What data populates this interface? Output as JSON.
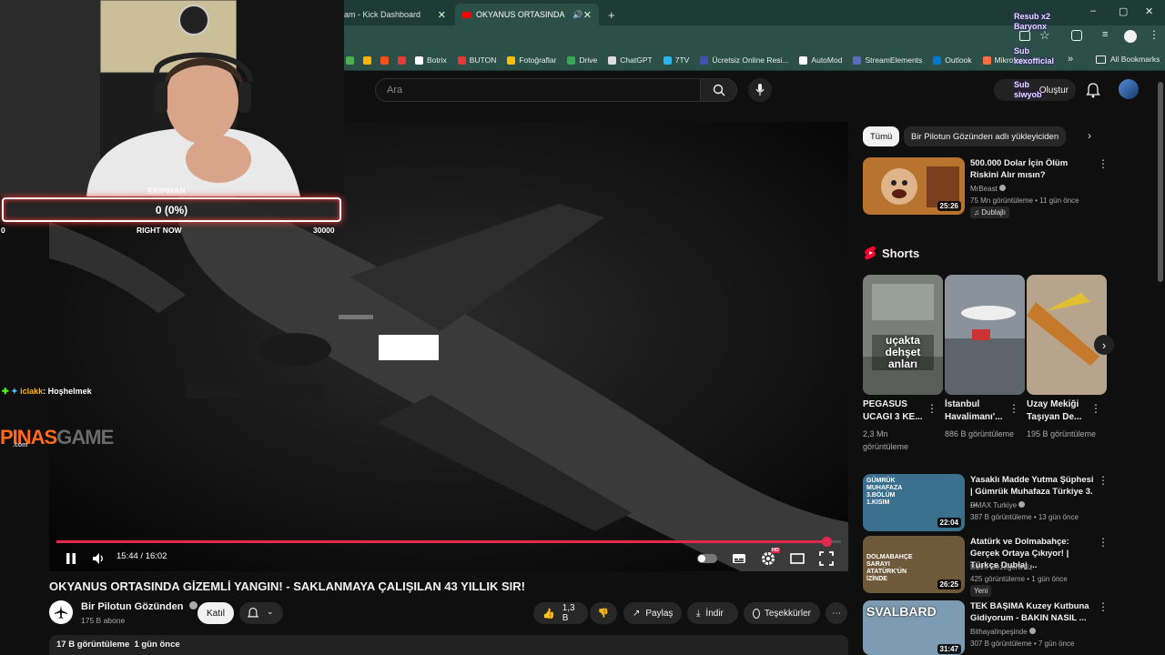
{
  "browser": {
    "tabs": [
      {
        "label": "am - Kick Dashboard",
        "active": false
      },
      {
        "label": "OKYANUS ORTASINDA GİZ",
        "active": true
      }
    ],
    "new_tab": "+",
    "window_controls": [
      "–",
      "▢",
      "✕"
    ],
    "bookmarks": [
      {
        "label": "",
        "color": "#4caf50"
      },
      {
        "label": "",
        "color": "#ffb300"
      },
      {
        "label": "",
        "color": "#f4511e"
      },
      {
        "label": "",
        "color": "#e53935"
      },
      {
        "label": "Botrix",
        "color": "#ffffff"
      },
      {
        "label": "BUTON",
        "color": "#e53935"
      },
      {
        "label": "Fotoğraflar",
        "color": "#fbbc04"
      },
      {
        "label": "Drive",
        "color": "#34a853"
      },
      {
        "label": "ChatGPT",
        "color": "#dddddd"
      },
      {
        "label": "7TV",
        "color": "#29b6f6"
      },
      {
        "label": "Ücretsiz Online Resi...",
        "color": "#3f51b5"
      },
      {
        "label": "AutoMod",
        "color": "#ffffff"
      },
      {
        "label": "StreamElements",
        "color": "#5c6bc0"
      },
      {
        "label": "Outlook",
        "color": "#0078d4"
      },
      {
        "label": "Mikrofon",
        "color": "#ff7043"
      }
    ],
    "bookmarks_more": "»",
    "all_bookmarks": "All Bookmarks"
  },
  "youtube": {
    "search_placeholder": "Ara",
    "create_label": "Oluştur",
    "video": {
      "title": "OKYANUS ORTASINDA GİZEMLİ YANGIN! - SAKLANMAYA ÇALIŞILAN 43 YILLIK SIR!",
      "timecode": "15:44 / 16:02",
      "progress": 0.981,
      "hd_badge": "HD"
    },
    "channel": {
      "name": "Bir Pilotun Gözünden",
      "subscribers": "175 B abone",
      "join_label": "Katıl"
    },
    "actions": {
      "likes": "1,3 B",
      "share": "Paylaş",
      "download": "İndir",
      "thanks": "Teşekkürler",
      "more": "⋯"
    },
    "description": {
      "views_date": "17 B görüntüleme  1 gün önce"
    },
    "chips": [
      "Tümü",
      "Bir Pilotun Gözünden adlı yükleyiciden"
    ],
    "shorts_heading": "Shorts",
    "recommended": [
      {
        "title": "500.000 Dolar İçin Ölüm Riskini Alır mısın?",
        "channel": "MrBeast",
        "meta": "75 Mn görüntüleme • 11 gün önce",
        "badge": "Dublajlı",
        "duration": "25:26",
        "thumb_color": "#b8742e"
      },
      {
        "title": "Yasaklı Madde Yutma Şüphesi | Gümrük Muhafaza Türkiye 3. ...",
        "channel": "DMAX Turkiye",
        "meta": "387 B görüntüleme • 13 gün önce",
        "badge": "",
        "duration": "22:04",
        "thumb_color": "#3a6f8e",
        "thumb_text": "GÜMRÜK MUHAFAZA 3.BÖLÜM 1.KISIM"
      },
      {
        "title": "Atatürk ve Dolmabahçe: Gerçek Ortaya Çıkıyor! | Türkçe Dublaj ...",
        "channel": "Bizim Gezegenimiz",
        "meta": "425 görüntüleme • 1 gün önce",
        "badge": "Yeni",
        "duration": "26:25",
        "thumb_color": "#6e5a3a",
        "thumb_text": "DOLMABAHÇE SARAYI ATATÜRK'ÜN İZİNDE"
      },
      {
        "title": "TEK BAŞIMA Kuzey Kutbuna Gidiyorum - BAKIN NASIL ...",
        "channel": "Bithayalinpeşinde",
        "meta": "307 B görüntüleme • 7 gün önce",
        "badge": "",
        "duration": "31:47",
        "thumb_color": "#7d9bb2",
        "thumb_text": "SVALBARD"
      }
    ],
    "shorts": [
      {
        "title": "PEGASUS UCAGI 3 KE...",
        "views": "2,3 Mn görüntüleme",
        "overlay": "uçakta dehşet anları",
        "color": "#7a7f7a"
      },
      {
        "title": "İstanbul Havalimanı'...",
        "views": "886 B görüntüleme",
        "overlay": "",
        "color": "#8a929b"
      },
      {
        "title": "Uzay Mekiği Taşıyan De...",
        "views": "195 B görüntüleme",
        "overlay": "",
        "color": "#c47a2a"
      }
    ]
  },
  "stream_overlay": {
    "goal_title": "EKIPMAN",
    "goal_value": "0 (0%)",
    "goal_min": "0",
    "goal_label": "RIGHT NOW",
    "goal_max": "30000",
    "chat_user": "iclakk",
    "chat_message": ": Hoşhelmek",
    "brand_a": "PINAS",
    "brand_b": "GAME",
    "brand_sub": ".com",
    "alerts": [
      "Resub x2",
      "Baryonx",
      "Sub",
      "xexofficial",
      "Sub",
      "siwyob"
    ]
  }
}
